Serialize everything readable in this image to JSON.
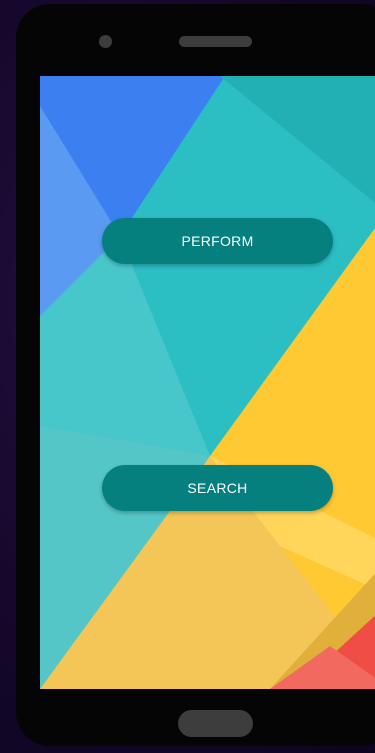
{
  "app": {
    "buttons": {
      "perform_label": "PERFORM",
      "search_label": "SEARCH"
    }
  },
  "colors": {
    "button_background": "#05807e",
    "button_text": "#ffffff",
    "device_frame": "#050505",
    "wallpaper_teal": "#2bbfc4",
    "wallpaper_blue": "#3b7ff0",
    "wallpaper_yellow": "#ffc933",
    "wallpaper_red": "#ef4d46"
  }
}
